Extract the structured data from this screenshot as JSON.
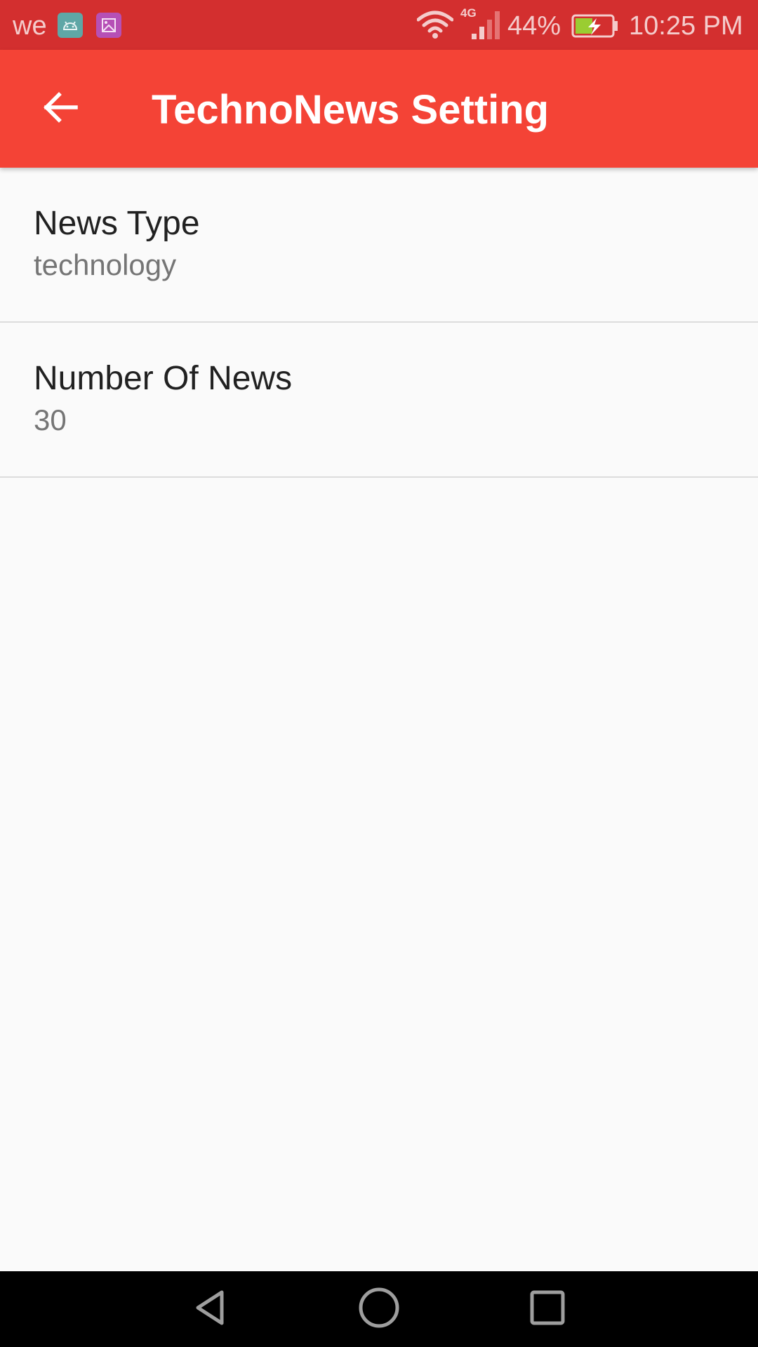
{
  "status_bar": {
    "carrier": "we",
    "network_type": "4G",
    "battery_percent": "44%",
    "time": "10:25 PM",
    "icons": [
      "android-notification-icon",
      "gallery-notification-icon",
      "wifi-icon",
      "cell-signal-icon",
      "battery-charging-icon"
    ]
  },
  "app_bar": {
    "title": "TechnoNews Setting",
    "back_icon": "arrow-left-icon"
  },
  "preferences": [
    {
      "title": "News Type",
      "summary": "technology"
    },
    {
      "title": "Number Of News",
      "summary": "30"
    }
  ],
  "nav_bar": {
    "icons": [
      "nav-back-icon",
      "nav-home-icon",
      "nav-recents-icon"
    ]
  },
  "colors": {
    "status_bar": "#d32f2f",
    "app_bar": "#f44336",
    "background": "#fafafa",
    "title_text": "#212121",
    "summary_text": "#757575",
    "divider": "#dcdcdc",
    "nav_bar": "#000000"
  }
}
